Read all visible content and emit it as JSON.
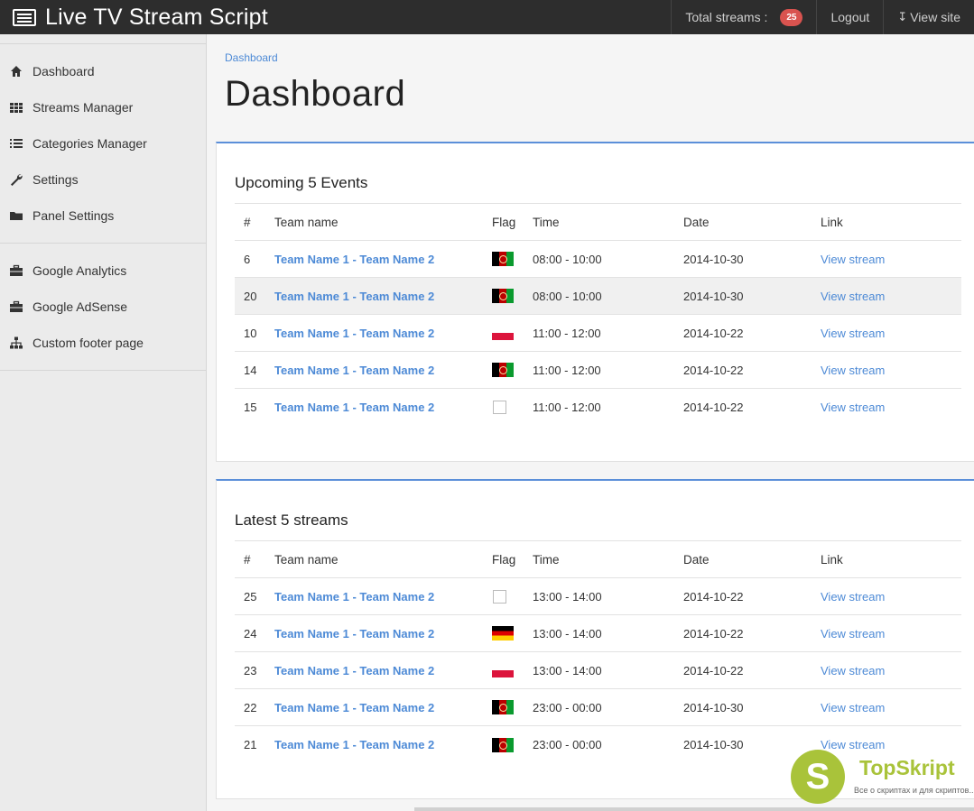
{
  "app": {
    "title": "Live TV Stream Script",
    "total_streams_label": "Total streams :",
    "total_streams_count": "25",
    "logout_label": "Logout",
    "view_site_label": "View site"
  },
  "sidebar": {
    "group1": [
      {
        "label": "Dashboard",
        "icon": "home-icon"
      },
      {
        "label": "Streams Manager",
        "icon": "grid-icon"
      },
      {
        "label": "Categories Manager",
        "icon": "list-icon"
      },
      {
        "label": "Settings",
        "icon": "wrench-icon"
      },
      {
        "label": "Panel Settings",
        "icon": "folder-icon"
      }
    ],
    "group2": [
      {
        "label": "Google Analytics",
        "icon": "briefcase-icon"
      },
      {
        "label": "Google AdSense",
        "icon": "briefcase-icon"
      },
      {
        "label": "Custom footer page",
        "icon": "sitemap-icon"
      }
    ]
  },
  "main": {
    "breadcrumb": "Dashboard",
    "page_title": "Dashboard",
    "columns": [
      "#",
      "Team name",
      "Flag",
      "Time",
      "Date",
      "Link"
    ],
    "upcoming": {
      "title": "Upcoming 5 Events",
      "rows": [
        {
          "num": "6",
          "team": "Team Name 1 - Team Name 2",
          "flag": "af",
          "time": "08:00 - 10:00",
          "date": "2014-10-30",
          "link": "View stream"
        },
        {
          "num": "20",
          "team": "Team Name 1 - Team Name 2",
          "flag": "af",
          "time": "08:00 - 10:00",
          "date": "2014-10-30",
          "link": "View stream"
        },
        {
          "num": "10",
          "team": "Team Name 1 - Team Name 2",
          "flag": "pl",
          "time": "11:00 - 12:00",
          "date": "2014-10-22",
          "link": "View stream"
        },
        {
          "num": "14",
          "team": "Team Name 1 - Team Name 2",
          "flag": "af",
          "time": "11:00 - 12:00",
          "date": "2014-10-22",
          "link": "View stream"
        },
        {
          "num": "15",
          "team": "Team Name 1 - Team Name 2",
          "flag": "none",
          "time": "11:00 - 12:00",
          "date": "2014-10-22",
          "link": "View stream"
        }
      ]
    },
    "latest": {
      "title": "Latest 5 streams",
      "rows": [
        {
          "num": "25",
          "team": "Team Name 1 - Team Name 2",
          "flag": "none",
          "time": "13:00 - 14:00",
          "date": "2014-10-22",
          "link": "View stream"
        },
        {
          "num": "24",
          "team": "Team Name 1 - Team Name 2",
          "flag": "de",
          "time": "13:00 - 14:00",
          "date": "2014-10-22",
          "link": "View stream"
        },
        {
          "num": "23",
          "team": "Team Name 1 - Team Name 2",
          "flag": "pl",
          "time": "13:00 - 14:00",
          "date": "2014-10-22",
          "link": "View stream"
        },
        {
          "num": "22",
          "team": "Team Name 1 - Team Name 2",
          "flag": "af",
          "time": "23:00 - 00:00",
          "date": "2014-10-30",
          "link": "View stream"
        },
        {
          "num": "21",
          "team": "Team Name 1 - Team Name 2",
          "flag": "af",
          "time": "23:00 - 00:00",
          "date": "2014-10-30",
          "link": "View stream"
        }
      ]
    }
  },
  "watermark": {
    "letter": "S",
    "name": "TopSkript",
    "tagline": "Все о скриптах и для скриптов..."
  }
}
